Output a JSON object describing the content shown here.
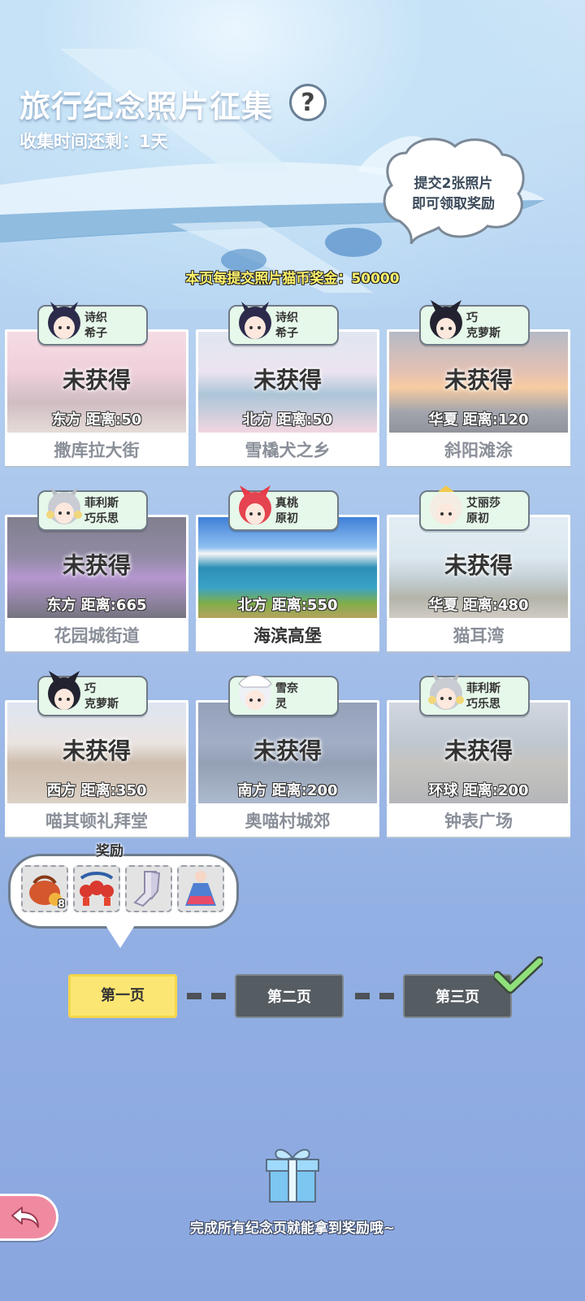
{
  "header": {
    "title": "旅行纪念照片征集",
    "help_icon": "?",
    "time_left": "收集时间还剩：1天"
  },
  "bubble": {
    "line1": "提交2张照片",
    "line2": "即可领取奖励"
  },
  "bonus_text": "本页每提交照片猫币奖金：50000",
  "cards": [
    {
      "place": "撒库拉大街",
      "status": "未获得",
      "distance": "东方  距离:50",
      "npc_line1": "诗织",
      "npc_line2": "希子",
      "obtained": false
    },
    {
      "place": "雪橇犬之乡",
      "status": "未获得",
      "distance": "北方  距离:50",
      "npc_line1": "诗织",
      "npc_line2": "希子",
      "obtained": false
    },
    {
      "place": "斜阳滩涂",
      "status": "未获得",
      "distance": "华夏  距离:120",
      "npc_line1": "巧",
      "npc_line2": "克萝斯",
      "obtained": false
    },
    {
      "place": "花园城街道",
      "status": "未获得",
      "distance": "东方  距离:665",
      "npc_line1": "菲利斯",
      "npc_line2": "巧乐思",
      "obtained": false
    },
    {
      "place": "海滨高堡",
      "status": "",
      "distance": "北方  距离:550",
      "npc_line1": "真桃",
      "npc_line2": "原初",
      "obtained": true
    },
    {
      "place": "猫耳湾",
      "status": "未获得",
      "distance": "华夏  距离:480",
      "npc_line1": "艾丽莎",
      "npc_line2": "原初",
      "obtained": false
    },
    {
      "place": "喵其顿礼拜堂",
      "status": "未获得",
      "distance": "西方  距离:350",
      "npc_line1": "巧",
      "npc_line2": "克萝斯",
      "obtained": false
    },
    {
      "place": "奥喵村城郊",
      "status": "未获得",
      "distance": "南方  距离:200",
      "npc_line1": "雪奈",
      "npc_line2": "灵",
      "obtained": false
    },
    {
      "place": "钟表广场",
      "status": "未获得",
      "distance": "环球  距离:200",
      "npc_line1": "菲利斯",
      "npc_line2": "巧乐思",
      "obtained": false
    }
  ],
  "reward": {
    "title": "奖励",
    "items": [
      {
        "icon": "bag-icon",
        "count": "8"
      },
      {
        "icon": "lantern-icon",
        "count": ""
      },
      {
        "icon": "stocking-icon",
        "count": ""
      },
      {
        "icon": "dress-icon",
        "count": ""
      }
    ]
  },
  "pages": [
    {
      "label": "第一页",
      "state": "active"
    },
    {
      "label": "第二页",
      "state": "inactive"
    },
    {
      "label": "第三页",
      "state": "inactive"
    }
  ],
  "footer": {
    "text": "完成所有纪念页就能拿到奖励哦~"
  },
  "colors": {
    "active_page": "#fbe673",
    "inactive_page": "#555c62",
    "bonus_text": "#fff36a",
    "tag_bg": "#e6f8ea",
    "back_button": "#f08aa0"
  }
}
